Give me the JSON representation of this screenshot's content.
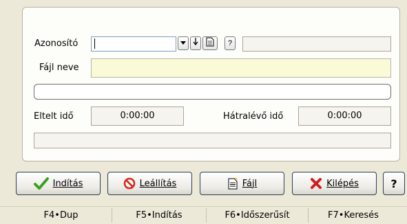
{
  "form": {
    "azonosito_label": "Azonosító",
    "azonosito_value": "",
    "azonosito_desc": "",
    "dropdown_icon": "chevron-down-icon",
    "arrow_icon": "arrow-down-icon",
    "doc_icon": "document-icon",
    "help_label": "?",
    "fajl_neve_label": "Fájl neve",
    "fajl_neve_value": "",
    "progress_percent": 0,
    "eltelt_label": "Eltelt idő",
    "eltelt_value": "0:00:00",
    "hatralevo_label": "Hátralévő idő",
    "hatralevo_value": "0:00:00",
    "message": ""
  },
  "buttons": {
    "inditas": "Indítás",
    "leallitas": "Leállítás",
    "fajl": "Fájl",
    "kilepes": "Kilépés",
    "help": "?"
  },
  "colors": {
    "highlight_field": "#fafad7",
    "check_green": "#3aa11e",
    "stop_red": "#d7261e",
    "exit_red": "#cc1f1f"
  },
  "statusbar": [
    {
      "label": "F4•Dup"
    },
    {
      "label": "F5•Indítás"
    },
    {
      "label": "F6•Időszerűsít"
    },
    {
      "label": "F7•Keresés"
    }
  ]
}
